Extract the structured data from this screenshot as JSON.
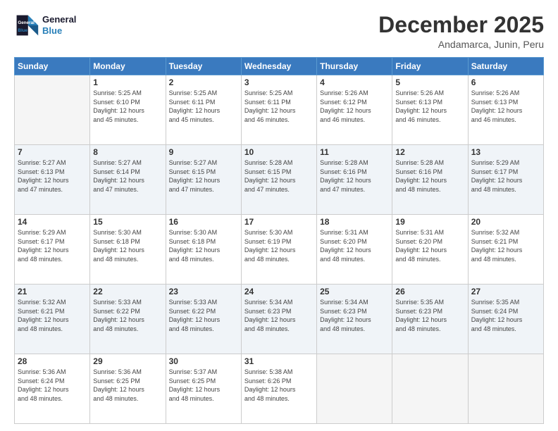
{
  "logo": {
    "line1": "General",
    "line2": "Blue"
  },
  "title": "December 2025",
  "subtitle": "Andamarca, Junin, Peru",
  "days_header": [
    "Sunday",
    "Monday",
    "Tuesday",
    "Wednesday",
    "Thursday",
    "Friday",
    "Saturday"
  ],
  "weeks": [
    [
      {
        "day": "",
        "info": ""
      },
      {
        "day": "1",
        "info": "Sunrise: 5:25 AM\nSunset: 6:10 PM\nDaylight: 12 hours\nand 45 minutes."
      },
      {
        "day": "2",
        "info": "Sunrise: 5:25 AM\nSunset: 6:11 PM\nDaylight: 12 hours\nand 45 minutes."
      },
      {
        "day": "3",
        "info": "Sunrise: 5:25 AM\nSunset: 6:11 PM\nDaylight: 12 hours\nand 46 minutes."
      },
      {
        "day": "4",
        "info": "Sunrise: 5:26 AM\nSunset: 6:12 PM\nDaylight: 12 hours\nand 46 minutes."
      },
      {
        "day": "5",
        "info": "Sunrise: 5:26 AM\nSunset: 6:13 PM\nDaylight: 12 hours\nand 46 minutes."
      },
      {
        "day": "6",
        "info": "Sunrise: 5:26 AM\nSunset: 6:13 PM\nDaylight: 12 hours\nand 46 minutes."
      }
    ],
    [
      {
        "day": "7",
        "info": "Sunrise: 5:27 AM\nSunset: 6:13 PM\nDaylight: 12 hours\nand 47 minutes."
      },
      {
        "day": "8",
        "info": "Sunrise: 5:27 AM\nSunset: 6:14 PM\nDaylight: 12 hours\nand 47 minutes."
      },
      {
        "day": "9",
        "info": "Sunrise: 5:27 AM\nSunset: 6:15 PM\nDaylight: 12 hours\nand 47 minutes."
      },
      {
        "day": "10",
        "info": "Sunrise: 5:28 AM\nSunset: 6:15 PM\nDaylight: 12 hours\nand 47 minutes."
      },
      {
        "day": "11",
        "info": "Sunrise: 5:28 AM\nSunset: 6:16 PM\nDaylight: 12 hours\nand 47 minutes."
      },
      {
        "day": "12",
        "info": "Sunrise: 5:28 AM\nSunset: 6:16 PM\nDaylight: 12 hours\nand 48 minutes."
      },
      {
        "day": "13",
        "info": "Sunrise: 5:29 AM\nSunset: 6:17 PM\nDaylight: 12 hours\nand 48 minutes."
      }
    ],
    [
      {
        "day": "14",
        "info": "Sunrise: 5:29 AM\nSunset: 6:17 PM\nDaylight: 12 hours\nand 48 minutes."
      },
      {
        "day": "15",
        "info": "Sunrise: 5:30 AM\nSunset: 6:18 PM\nDaylight: 12 hours\nand 48 minutes."
      },
      {
        "day": "16",
        "info": "Sunrise: 5:30 AM\nSunset: 6:18 PM\nDaylight: 12 hours\nand 48 minutes."
      },
      {
        "day": "17",
        "info": "Sunrise: 5:30 AM\nSunset: 6:19 PM\nDaylight: 12 hours\nand 48 minutes."
      },
      {
        "day": "18",
        "info": "Sunrise: 5:31 AM\nSunset: 6:20 PM\nDaylight: 12 hours\nand 48 minutes."
      },
      {
        "day": "19",
        "info": "Sunrise: 5:31 AM\nSunset: 6:20 PM\nDaylight: 12 hours\nand 48 minutes."
      },
      {
        "day": "20",
        "info": "Sunrise: 5:32 AM\nSunset: 6:21 PM\nDaylight: 12 hours\nand 48 minutes."
      }
    ],
    [
      {
        "day": "21",
        "info": "Sunrise: 5:32 AM\nSunset: 6:21 PM\nDaylight: 12 hours\nand 48 minutes."
      },
      {
        "day": "22",
        "info": "Sunrise: 5:33 AM\nSunset: 6:22 PM\nDaylight: 12 hours\nand 48 minutes."
      },
      {
        "day": "23",
        "info": "Sunrise: 5:33 AM\nSunset: 6:22 PM\nDaylight: 12 hours\nand 48 minutes."
      },
      {
        "day": "24",
        "info": "Sunrise: 5:34 AM\nSunset: 6:23 PM\nDaylight: 12 hours\nand 48 minutes."
      },
      {
        "day": "25",
        "info": "Sunrise: 5:34 AM\nSunset: 6:23 PM\nDaylight: 12 hours\nand 48 minutes."
      },
      {
        "day": "26",
        "info": "Sunrise: 5:35 AM\nSunset: 6:23 PM\nDaylight: 12 hours\nand 48 minutes."
      },
      {
        "day": "27",
        "info": "Sunrise: 5:35 AM\nSunset: 6:24 PM\nDaylight: 12 hours\nand 48 minutes."
      }
    ],
    [
      {
        "day": "28",
        "info": "Sunrise: 5:36 AM\nSunset: 6:24 PM\nDaylight: 12 hours\nand 48 minutes."
      },
      {
        "day": "29",
        "info": "Sunrise: 5:36 AM\nSunset: 6:25 PM\nDaylight: 12 hours\nand 48 minutes."
      },
      {
        "day": "30",
        "info": "Sunrise: 5:37 AM\nSunset: 6:25 PM\nDaylight: 12 hours\nand 48 minutes."
      },
      {
        "day": "31",
        "info": "Sunrise: 5:38 AM\nSunset: 6:26 PM\nDaylight: 12 hours\nand 48 minutes."
      },
      {
        "day": "",
        "info": ""
      },
      {
        "day": "",
        "info": ""
      },
      {
        "day": "",
        "info": ""
      }
    ]
  ]
}
